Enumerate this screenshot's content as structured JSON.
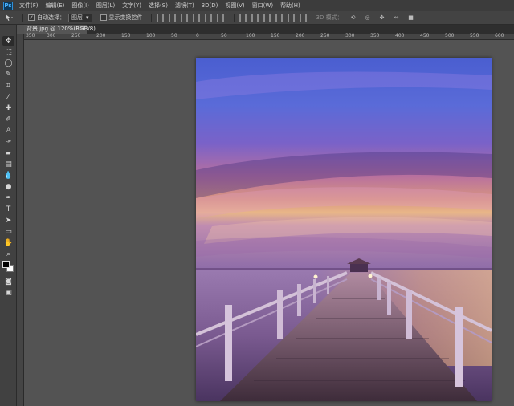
{
  "menubar": {
    "logo": "Ps",
    "items": [
      "文件(F)",
      "编辑(E)",
      "图像(I)",
      "图层(L)",
      "文字(Y)",
      "选择(S)",
      "滤镜(T)",
      "3D(D)",
      "视图(V)",
      "窗口(W)",
      "帮助(H)"
    ]
  },
  "options": {
    "auto_select_label": "自动选择：",
    "auto_select_value": "图层",
    "show_transform_label": "显示变换控件",
    "mode_3d_label": "3D 模式："
  },
  "document_tab": {
    "title": "背景.jpg @ 120%(RGB/8)",
    "close": "×"
  },
  "ruler": {
    "labels": [
      "350",
      "300",
      "250",
      "200",
      "150",
      "100",
      "50",
      "0",
      "50",
      "100",
      "150",
      "200",
      "250",
      "300",
      "350",
      "400",
      "450",
      "500",
      "550",
      "600"
    ]
  },
  "colors": {
    "foreground": "#000000",
    "background": "#ffffff",
    "accent": "#2f8fd8"
  }
}
